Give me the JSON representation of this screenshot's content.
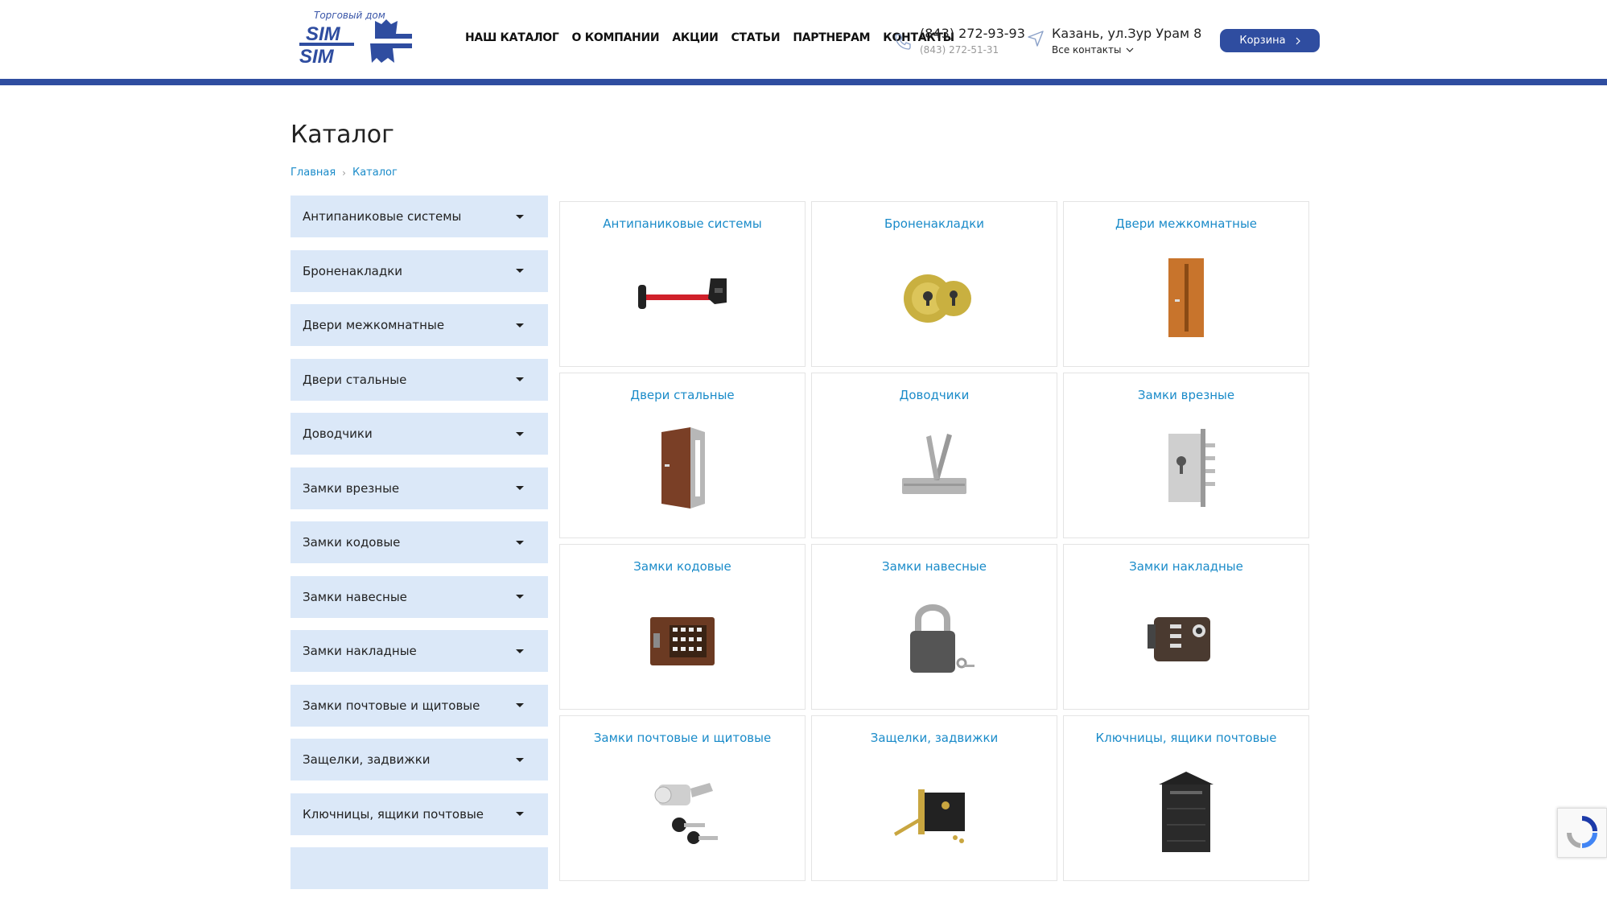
{
  "header": {
    "logo": {
      "subtitle": "Торговый дом",
      "line1": "SIM",
      "line2": "SIM"
    },
    "nav": [
      "НАШ КАТАЛОГ",
      "О КОМПАНИИ",
      "АКЦИИ",
      "СТАТЬИ",
      "ПАРТНЕРАМ",
      "КОНТАКТЫ"
    ],
    "phone_main": "(843) 272-93-93",
    "phone_sub": "(843) 272-51-31",
    "address": "Казань, ул.Зур Урам 8",
    "all_contacts": "Все контакты",
    "cart_label": "Корзина"
  },
  "page": {
    "title": "Каталог",
    "breadcrumb": [
      "Главная",
      "Каталог"
    ]
  },
  "sidebar": {
    "items": [
      "Антипаниковые системы",
      "Броненакладки",
      "Двери межкомнатные",
      "Двери стальные",
      "Доводчики",
      "Замки врезные",
      "Замки кодовые",
      "Замки навесные",
      "Замки накладные",
      "Замки почтовые и щитовые",
      "Защелки, задвижки",
      "Ключницы, ящики почтовые",
      ""
    ]
  },
  "catalog": {
    "cards": [
      {
        "title": "Антипаниковые системы",
        "icon": "panic-bar-icon"
      },
      {
        "title": "Броненакладки",
        "icon": "armor-plate-icon"
      },
      {
        "title": "Двери межкомнатные",
        "icon": "interior-door-icon"
      },
      {
        "title": "Двери стальные",
        "icon": "steel-door-icon"
      },
      {
        "title": "Доводчики",
        "icon": "door-closer-icon"
      },
      {
        "title": "Замки врезные",
        "icon": "mortise-lock-icon"
      },
      {
        "title": "Замки кодовые",
        "icon": "code-lock-icon"
      },
      {
        "title": "Замки навесные",
        "icon": "padlock-icon"
      },
      {
        "title": "Замки накладные",
        "icon": "rim-lock-icon"
      },
      {
        "title": "Замки почтовые и щитовые",
        "icon": "cam-lock-icon"
      },
      {
        "title": "Защелки, задвижки",
        "icon": "latch-icon"
      },
      {
        "title": "Ключницы, ящики почтовые",
        "icon": "mailbox-icon"
      }
    ]
  },
  "colors": {
    "brand": "#2f4da0",
    "link": "#1a8bc9",
    "sidebar_bg": "#dbe8f8"
  }
}
